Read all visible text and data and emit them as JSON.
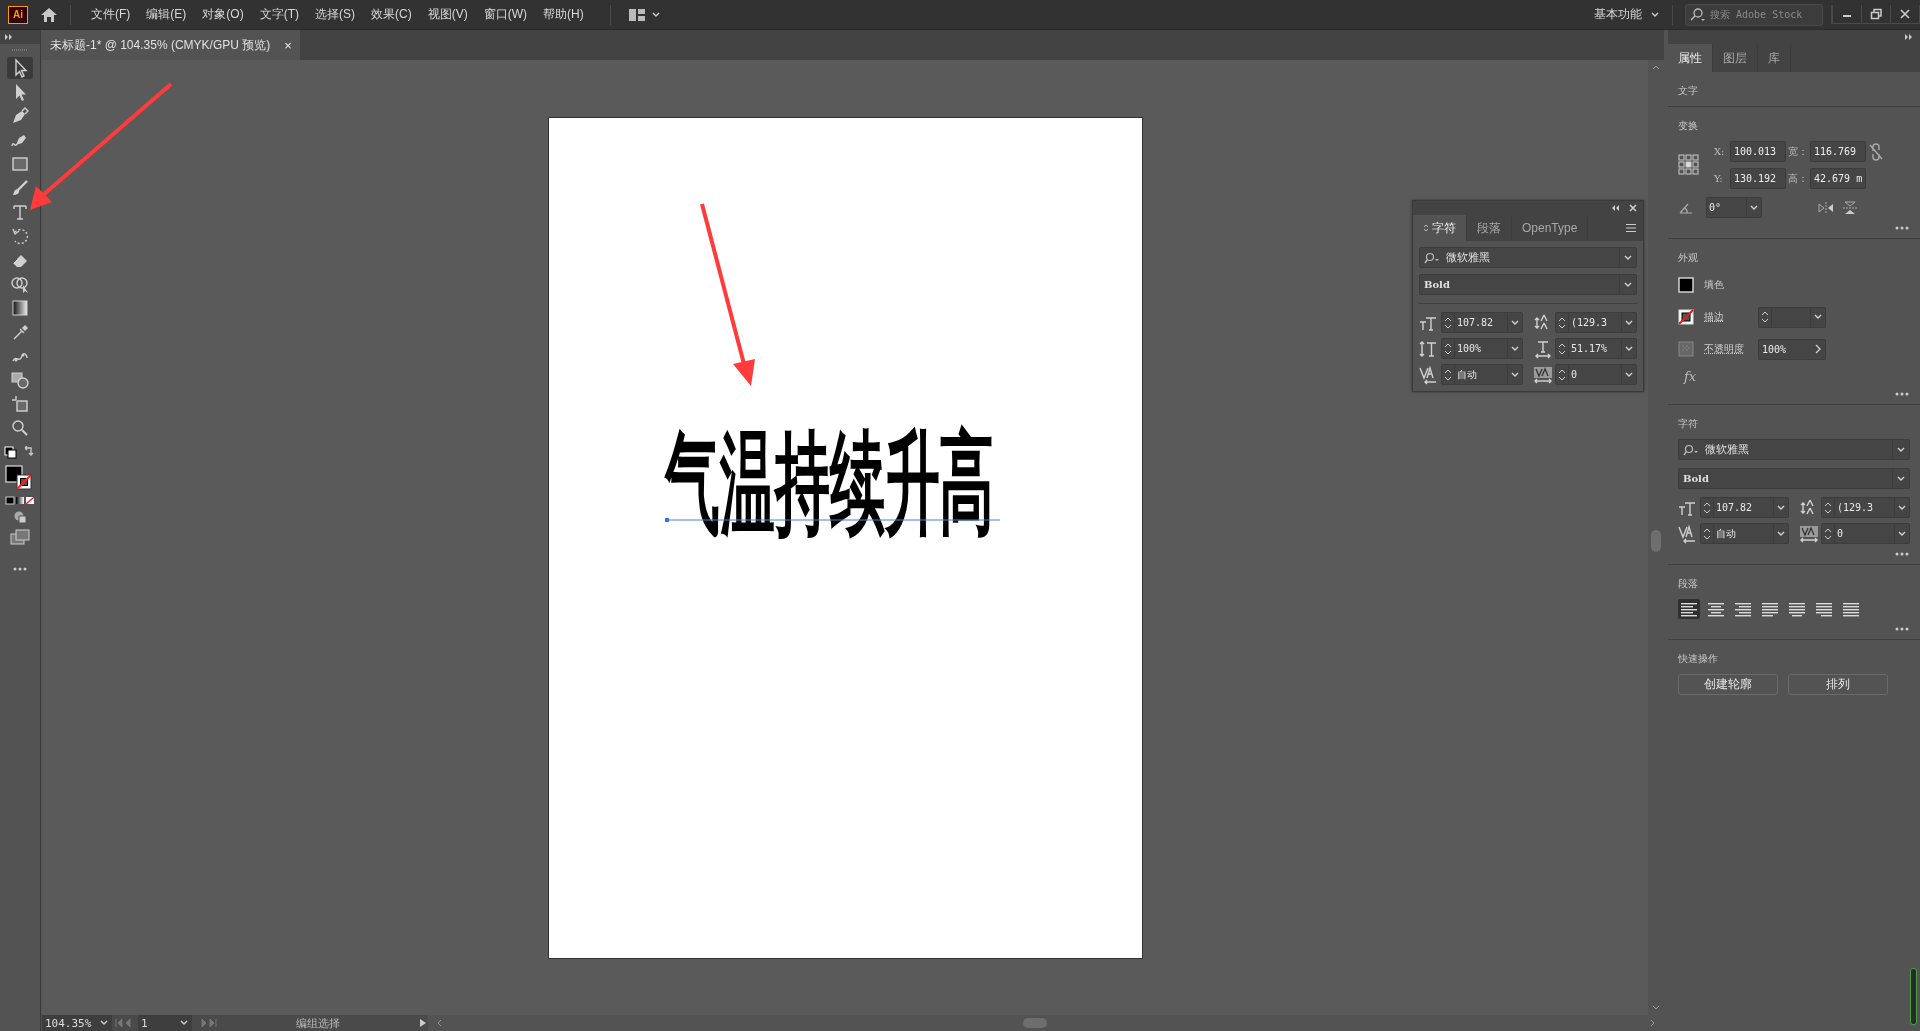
{
  "menu_bar": {
    "app_logo": "Ai",
    "items": [
      "文件(F)",
      "编辑(E)",
      "对象(O)",
      "文字(T)",
      "选择(S)",
      "效果(C)",
      "视图(V)",
      "窗口(W)",
      "帮助(H)"
    ],
    "workspace": "基本功能",
    "search": {
      "placeholder": "搜索 Adobe Stock"
    }
  },
  "document_tab": {
    "title": "未标题-1* @ 104.35% (CMYK/GPU 预览)",
    "close": "×"
  },
  "tools": [
    {
      "kind": "selection",
      "selected": true
    },
    {
      "kind": "direct-selection",
      "selected": false
    },
    {
      "kind": "pen",
      "selected": false
    },
    {
      "kind": "curvature",
      "selected": false
    },
    {
      "kind": "rectangle",
      "selected": false
    },
    {
      "kind": "paintbrush",
      "selected": false
    },
    {
      "kind": "type",
      "selected": false
    },
    {
      "kind": "rotate",
      "selected": false
    },
    {
      "kind": "eraser",
      "selected": false
    },
    {
      "kind": "shape-builder",
      "selected": false
    },
    {
      "kind": "gradient",
      "selected": false
    },
    {
      "kind": "eyedropper",
      "selected": false
    },
    {
      "kind": "puppet-warp",
      "selected": false
    },
    {
      "kind": "blend",
      "selected": false
    },
    {
      "kind": "artboard",
      "selected": false
    },
    {
      "kind": "zoom",
      "selected": false
    }
  ],
  "artboard": {
    "text": "气温持续升高"
  },
  "character_panel": {
    "tabs": [
      {
        "label": "字符",
        "selected": true
      },
      {
        "label": "段落",
        "selected": false
      },
      {
        "label": "OpenType",
        "selected": false
      }
    ],
    "font": "微软雅黑",
    "style": "Bold",
    "fields": [
      {
        "kind": "font-size",
        "value": "107.82"
      },
      {
        "kind": "leading",
        "value": "(129.3"
      },
      {
        "kind": "vertical-scale",
        "value": "100%"
      },
      {
        "kind": "horizontal-scale",
        "value": "51.17%"
      },
      {
        "kind": "kerning",
        "value": "自动"
      },
      {
        "kind": "tracking",
        "value": "0"
      }
    ]
  },
  "properties_panel": {
    "tabs": [
      {
        "label": "属性",
        "selected": true
      },
      {
        "label": "图层",
        "selected": false
      },
      {
        "label": "库",
        "selected": false
      }
    ],
    "object_type": "文字",
    "transform": {
      "title": "变换",
      "fields": [
        {
          "label": "X:",
          "value": "100.013"
        },
        {
          "label": "宽：",
          "value": "116.769"
        },
        {
          "label": "Y:",
          "value": "130.192"
        },
        {
          "label": "高：",
          "value": "42.679 m"
        }
      ],
      "angle": "0°"
    },
    "appearance": {
      "title": "外观",
      "fill_label": "填色",
      "stroke_label": "描边",
      "opacity_label": "不透明度",
      "opacity": "100%",
      "fx": "fx"
    },
    "character": {
      "title": "字符",
      "font": "微软雅黑",
      "style": "Bold",
      "fields": [
        {
          "kind": "font-size",
          "value": "107.82"
        },
        {
          "kind": "leading",
          "value": "(129.3"
        },
        {
          "kind": "kerning",
          "value": "自动"
        },
        {
          "kind": "tracking",
          "value": "0"
        }
      ]
    },
    "paragraph": {
      "title": "段落",
      "alignments": [
        {
          "kind": "left",
          "selected": true
        },
        {
          "kind": "center",
          "selected": false
        },
        {
          "kind": "right",
          "selected": false
        },
        {
          "kind": "justify-left",
          "selected": false
        },
        {
          "kind": "justify-center",
          "selected": false
        },
        {
          "kind": "justify-right",
          "selected": false
        },
        {
          "kind": "justify-all",
          "selected": false
        }
      ]
    },
    "quick_actions": {
      "title": "快速操作",
      "buttons": [
        "创建轮廓",
        "排列"
      ]
    }
  },
  "status_bar": {
    "zoom": "104.35%",
    "page": "1",
    "tool": "编组选择"
  }
}
